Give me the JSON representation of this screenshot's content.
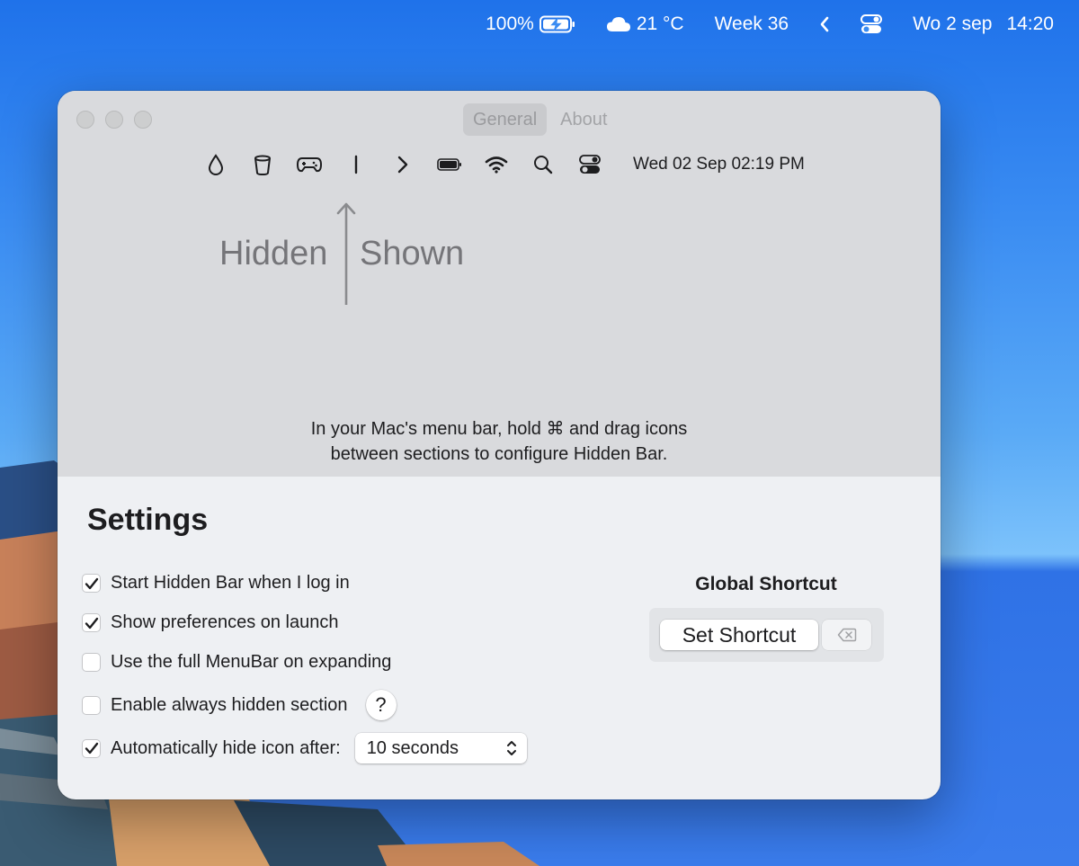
{
  "menubar": {
    "battery_percent": "100%",
    "weather": "21 °C",
    "week": "Week 36",
    "date": "Wo 2 sep",
    "time": "14:20"
  },
  "window": {
    "tabs": [
      {
        "label": "General",
        "active": true
      },
      {
        "label": "About",
        "active": false
      }
    ],
    "preview": {
      "icons": [
        "drop-icon",
        "cylinder-icon",
        "gamepad-icon",
        "separator-bar-icon",
        "chevron-right-icon",
        "battery-icon",
        "wifi-icon",
        "search-icon",
        "control-center-icon"
      ],
      "datetime": "Wed 02 Sep 02:19 PM"
    },
    "hidden_label": "Hidden",
    "shown_label": "Shown",
    "instructions": {
      "line1": "In your Mac's menu bar, hold ⌘ and drag icons",
      "line2": "between sections to configure Hidden Bar."
    }
  },
  "settings": {
    "title": "Settings",
    "options": [
      {
        "label": "Start Hidden Bar when I log in",
        "checked": true
      },
      {
        "label": "Show preferences on launch",
        "checked": true
      },
      {
        "label": "Use the full MenuBar on expanding",
        "checked": false
      },
      {
        "label": "Enable always hidden section",
        "checked": false
      },
      {
        "label": "Automatically hide icon after:",
        "checked": true
      }
    ],
    "help_label": "?",
    "hide_delay": "10 seconds",
    "global_shortcut": {
      "title": "Global Shortcut",
      "button_label": "Set Shortcut"
    }
  },
  "colors": {
    "desktop_blue": "#3a8cf2",
    "window_top": "#d9dadd",
    "window_bottom": "#eef0f3",
    "muted_text": "#757579"
  }
}
